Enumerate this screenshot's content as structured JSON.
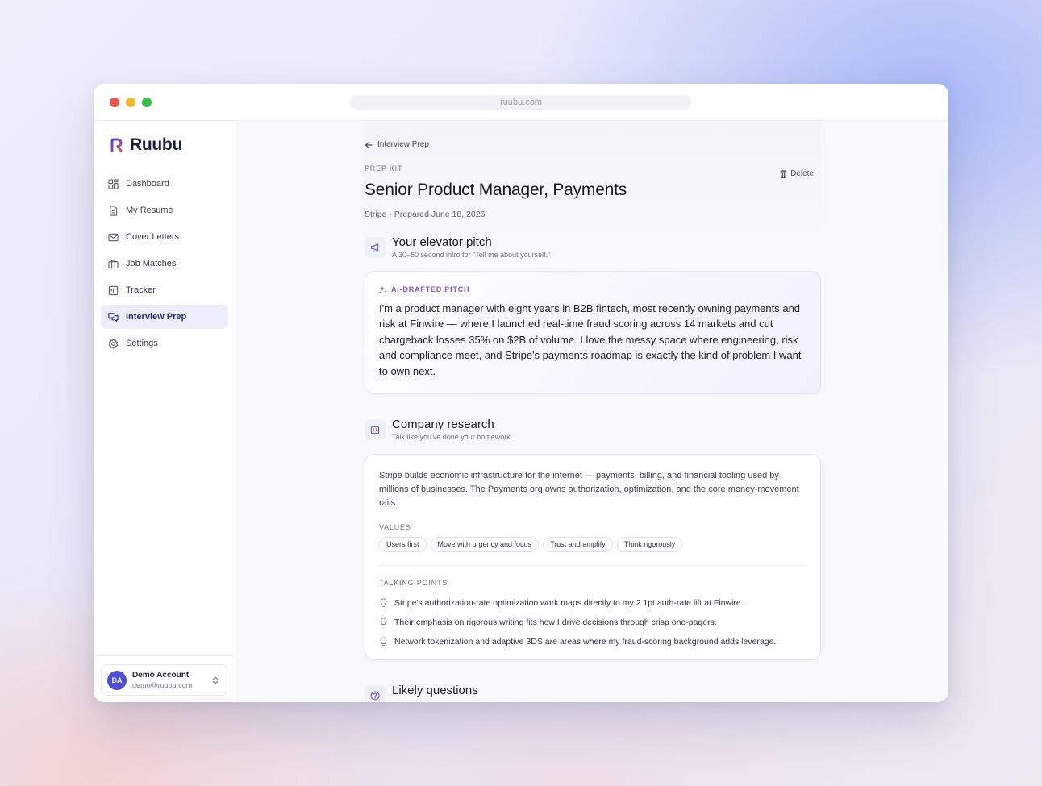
{
  "browser": {
    "url": "ruubu.com"
  },
  "sidebar": {
    "brand": "Ruubu",
    "items": [
      {
        "label": "Dashboard",
        "icon": "dashboard-icon"
      },
      {
        "label": "My Resume",
        "icon": "document-icon"
      },
      {
        "label": "Cover Letters",
        "icon": "mail-icon"
      },
      {
        "label": "Job Matches",
        "icon": "briefcase-icon"
      },
      {
        "label": "Tracker",
        "icon": "kanban-icon"
      },
      {
        "label": "Interview Prep",
        "icon": "chat-icon",
        "active": true
      },
      {
        "label": "Settings",
        "icon": "gear-icon"
      }
    ],
    "account": {
      "initials": "DA",
      "name": "Demo Account",
      "email": "demo@ruubu.com"
    }
  },
  "page": {
    "back_label": "Interview Prep",
    "kicker": "PREP KIT",
    "title": "Senior Product Manager, Payments",
    "subtitle": "Stripe · Prepared June 18, 2026",
    "delete_label": "Delete"
  },
  "elevator": {
    "title": "Your elevator pitch",
    "subtitle": "A 30–60 second intro for “Tell me about yourself.”",
    "label": "AI-DRAFTED PITCH",
    "text": "I'm a product manager with eight years in B2B fintech, most recently owning payments and risk at Finwire — where I launched real-time fraud scoring across 14 markets and cut chargeback losses 35% on $2B of volume. I love the messy space where engineering, risk and compliance meet, and Stripe's payments roadmap is exactly the kind of problem I want to own next."
  },
  "research": {
    "title": "Company research",
    "subtitle": "Talk like you've done your homework.",
    "text": "Stripe builds economic infrastructure for the internet — payments, billing, and financial tooling used by millions of businesses. The Payments org owns authorization, optimization, and the core money-movement rails.",
    "values_label": "VALUES",
    "values": [
      "Users first",
      "Move with urgency and focus",
      "Trust and amplify",
      "Think rigorously"
    ],
    "talking_label": "TALKING POINTS",
    "talking_points": [
      "Stripe's authorization-rate optimization work maps directly to my 2.1pt auth-rate lift at Finwire.",
      "Their emphasis on rigorous writing fits how I drive decisions through crisp one-pagers.",
      "Network tokenization and adaptive 3DS are areas where my fraud-scoring background adds leverage."
    ]
  },
  "questions": {
    "title": "Likely questions"
  },
  "colors": {
    "accent": "#4d4fd6",
    "active_nav_bg": "#eceefb",
    "pitch_label": "#7a57c8"
  }
}
